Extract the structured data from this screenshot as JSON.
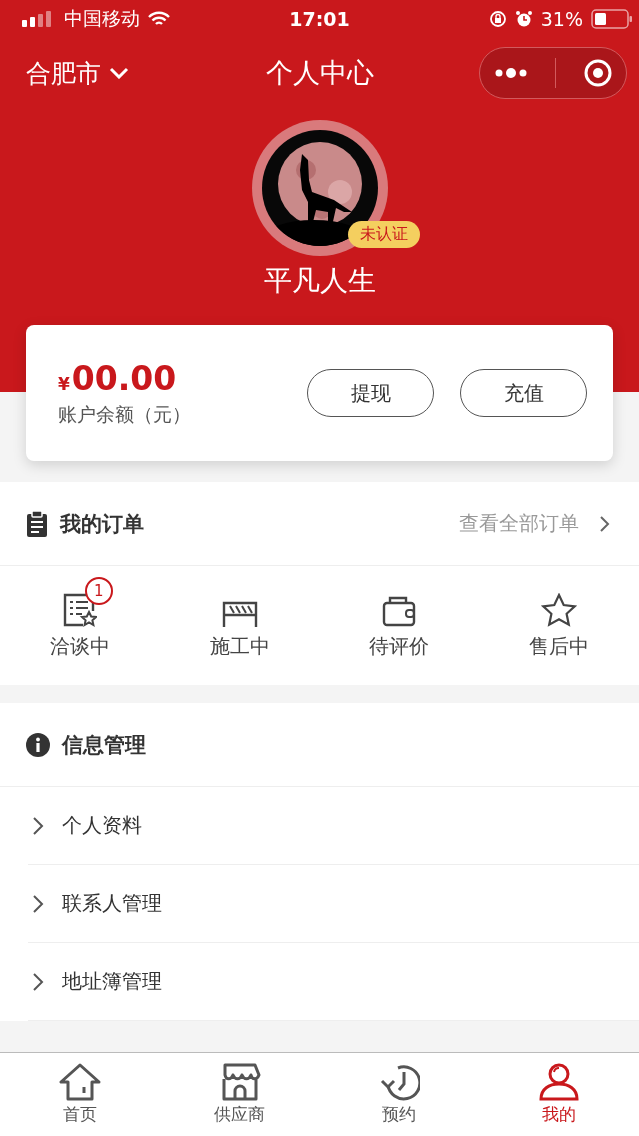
{
  "status_bar": {
    "carrier": "中国移动",
    "time": "17:01",
    "battery": "31%"
  },
  "nav": {
    "city": "合肥市",
    "title": "个人中心"
  },
  "profile": {
    "name": "平凡人生",
    "badge": "未认证"
  },
  "balance": {
    "currency": "¥",
    "amount": "00.00",
    "label": "账户余额（元）",
    "buttons": [
      "提现",
      "充值"
    ]
  },
  "orders": {
    "title": "我的订单",
    "link": "查看全部订单",
    "items": [
      {
        "kind": "talk",
        "label": "洽谈中",
        "count": "1"
      },
      {
        "kind": "build",
        "label": "施工中"
      },
      {
        "kind": "wallet",
        "label": "待评价"
      },
      {
        "kind": "star",
        "label": "售后中"
      }
    ]
  },
  "info": {
    "title": "信息管理",
    "items": [
      {
        "label": "个人资料"
      },
      {
        "label": "联系人管理"
      },
      {
        "label": "地址簿管理"
      }
    ]
  },
  "tab_bar": [
    {
      "kind": "home",
      "label": "首页",
      "selected": false
    },
    {
      "kind": "shop",
      "label": "供应商",
      "selected": false
    },
    {
      "kind": "clock",
      "label": "预约",
      "selected": false
    },
    {
      "kind": "user",
      "label": "我的",
      "selected": true
    }
  ]
}
